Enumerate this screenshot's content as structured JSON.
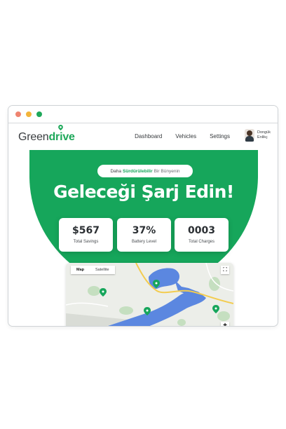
{
  "window": {
    "controls": [
      "#ef8470",
      "#f3b43a",
      "#1ea85a"
    ]
  },
  "nav": {
    "logo_prefix": "Green",
    "logo_suffix": "drive",
    "menu": [
      "Dashboard",
      "Vehicles",
      "Settings"
    ],
    "user": {
      "first_name": "Dongük",
      "last_name": "Enlikç"
    }
  },
  "hero": {
    "pill_part1": "Daha",
    "pill_accent": "Sürdürülebilir",
    "pill_part2": "Bir Bünyenin",
    "headline": "Geleceği Şarj Edin!"
  },
  "stats": [
    {
      "value": "$567",
      "label": "Total Savings"
    },
    {
      "value": "37%",
      "label": "Battery Level"
    },
    {
      "value": "0003",
      "label": "Total Charges"
    }
  ],
  "map": {
    "tabs": [
      "Map",
      "Satellite"
    ],
    "active_tab": "Map",
    "fullscreen_icon": "fullscreen-icon",
    "zoom_label": "+"
  },
  "colors": {
    "brand": "#16a65b",
    "water": "#5b87e0",
    "park": "#c5dfc0",
    "road": "#f3cc4f"
  }
}
